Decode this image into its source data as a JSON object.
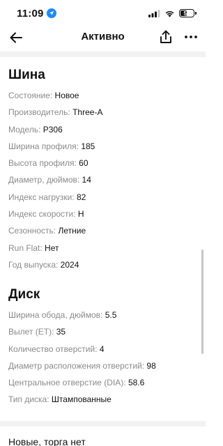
{
  "status_bar": {
    "time": "11:09",
    "battery": "50",
    "battery_level": 0.5
  },
  "nav": {
    "title": "Активно"
  },
  "tire": {
    "title": "Шина",
    "rows": [
      {
        "key": "Состояние: ",
        "value": "Новое"
      },
      {
        "key": "Производитель: ",
        "value": "Three-A"
      },
      {
        "key": "Модель: ",
        "value": "P306"
      },
      {
        "key": "Ширина профиля: ",
        "value": "185"
      },
      {
        "key": "Высота профиля: ",
        "value": "60"
      },
      {
        "key": "Диаметр, дюймов: ",
        "value": "14"
      },
      {
        "key": "Индекс нагрузки: ",
        "value": "82"
      },
      {
        "key": "Индекс скорости: ",
        "value": "H"
      },
      {
        "key": "Сезонность: ",
        "value": "Летние"
      },
      {
        "key": "Run Flat: ",
        "value": "Нет"
      },
      {
        "key": "Год выпуска: ",
        "value": "2024"
      }
    ]
  },
  "disk": {
    "title": "Диск",
    "rows": [
      {
        "key": "Ширина обода, дюймов: ",
        "value": "5.5"
      },
      {
        "key": "Вылет (ET): ",
        "value": "35"
      },
      {
        "key": "Количество отверстий: ",
        "value": "4"
      },
      {
        "key": "Диаметр расположения отверстий: ",
        "value": "98"
      },
      {
        "key": "Центральное отверстие (DIA): ",
        "value": "58.6"
      },
      {
        "key": "Тип диска: ",
        "value": "Штампованные"
      }
    ]
  },
  "footer": {
    "title": "Новые, торга нет"
  }
}
